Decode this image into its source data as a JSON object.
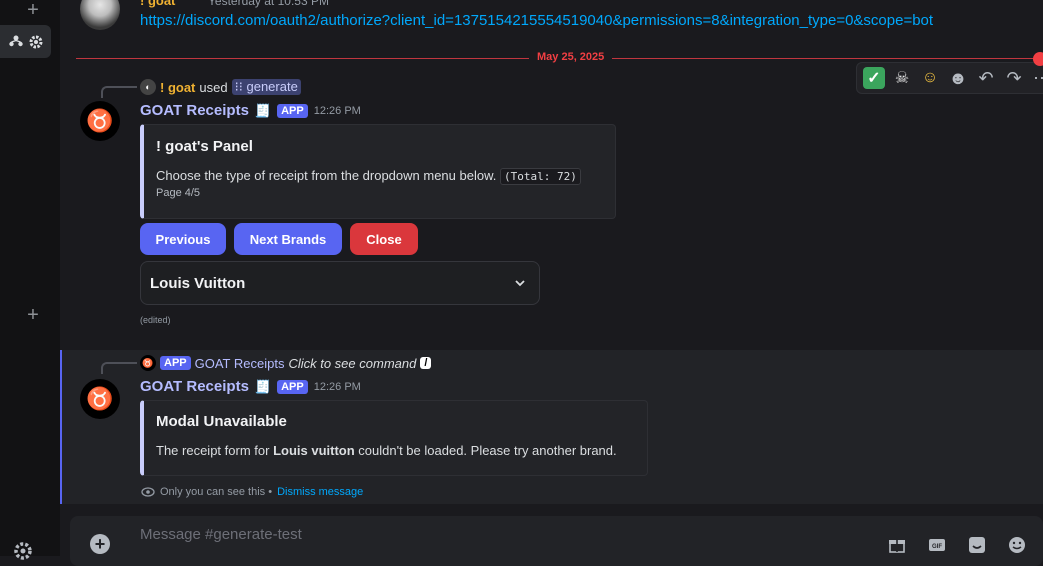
{
  "top_message": {
    "name": "! goat",
    "timestamp": "Yesterday at 10:53 PM",
    "link": "https://discord.com/oauth2/authorize?client_id=1375154215554519040&permissions=8&integration_type=0&scope=bot"
  },
  "date_divider": "May 25, 2025",
  "reaction_bar": {
    "emojis": [
      "check-mark",
      "skull",
      "clown"
    ],
    "tools": [
      "add-reaction",
      "reply",
      "forward",
      "more"
    ]
  },
  "message1": {
    "reply_user": "! goat",
    "reply_used": "used",
    "reply_command": "generate",
    "author": "GOAT Receipts",
    "app_tag": "APP",
    "timestamp": "12:26 PM",
    "embed_title": "! goat's Panel",
    "embed_desc": "Choose the type of receipt from the dropdown menu below.",
    "embed_code": "(Total: 72)",
    "embed_page": "Page 4/5",
    "buttons": {
      "previous": "Previous",
      "next": "Next Brands",
      "close": "Close"
    },
    "select_value": "Louis Vuitton",
    "edited": "(edited)"
  },
  "message2": {
    "reply_app_tag": "APP",
    "reply_author": "GOAT Receipts",
    "reply_hint": "Click to see command",
    "author": "GOAT Receipts",
    "app_tag": "APP",
    "timestamp": "12:26 PM",
    "embed_title": "Modal Unavailable",
    "embed_desc_before": "The receipt form for",
    "embed_desc_brand": "Louis vuitton",
    "embed_desc_after": "couldn't be loaded. Please try another brand.",
    "only_you": "Only you can see this •",
    "dismiss": "Dismiss message"
  },
  "composer": {
    "placeholder": "Message #generate-test",
    "icons": [
      "gift-icon",
      "gif-icon",
      "sticker-icon",
      "emoji-icon"
    ]
  },
  "colors": {
    "accent": "#5865f2",
    "danger": "#da373c",
    "link": "#00a8fc",
    "date": "#f23f43"
  }
}
